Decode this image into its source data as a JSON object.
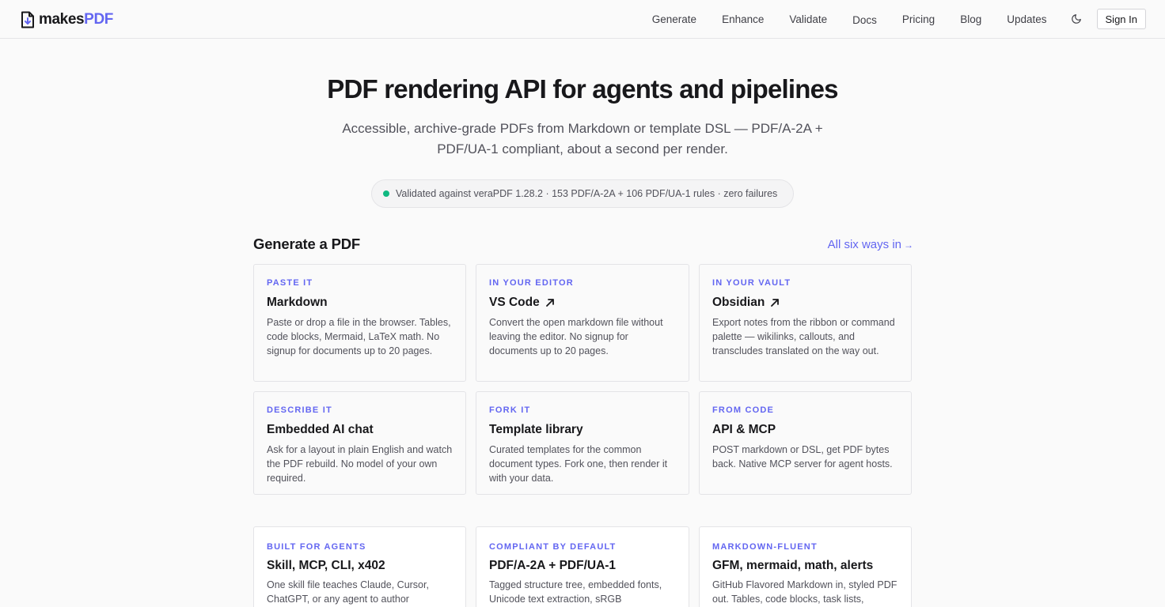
{
  "header": {
    "logo": {
      "prefix": "makes",
      "accent": "PDF",
      "icon": "document-download-icon"
    },
    "nav": [
      {
        "label": "Generate"
      },
      {
        "label": "Enhance"
      },
      {
        "label": "Validate"
      },
      {
        "label": "Docs"
      },
      {
        "label": "Pricing"
      },
      {
        "label": "Blog"
      },
      {
        "label": "Updates"
      }
    ],
    "theme_icon": "moon-icon",
    "signin_label": "Sign In"
  },
  "hero": {
    "title": "PDF rendering API for agents and pipelines",
    "subtitle": "Accessible, archive-grade PDFs from Markdown or template DSL — PDF/A-2A + PDF/UA-1 compliant, about a second per render.",
    "badge": "Validated against veraPDF 1.28.2 · 153 PDF/A-2A + 106 PDF/UA-1 rules · zero failures"
  },
  "generate": {
    "title": "Generate a PDF",
    "link_label": "All six ways in",
    "link_arrow": "→",
    "cards": [
      {
        "kicker": "Paste it",
        "title": "Markdown",
        "external": false,
        "desc": "Paste or drop a file in the browser. Tables, code blocks, Mermaid, LaTeX math. No signup for documents up to 20 pages."
      },
      {
        "kicker": "In your editor",
        "title": "VS Code",
        "external": true,
        "desc": "Convert the open markdown file without leaving the editor. No signup for documents up to 20 pages."
      },
      {
        "kicker": "In your vault",
        "title": "Obsidian",
        "external": true,
        "desc": "Export notes from the ribbon or command palette — wikilinks, callouts, and transcludes translated on the way out."
      },
      {
        "kicker": "Describe it",
        "title": "Embedded AI chat",
        "external": false,
        "desc": "Ask for a layout in plain English and watch the PDF rebuild. No model of your own required."
      },
      {
        "kicker": "Fork it",
        "title": "Template library",
        "external": false,
        "desc": "Curated templates for the common document types. Fork one, then render it with your data."
      },
      {
        "kicker": "From code",
        "title": "API & MCP",
        "external": false,
        "desc": "POST markdown or DSL, get PDF bytes back. Native MCP server for agent hosts."
      }
    ]
  },
  "features": {
    "cards": [
      {
        "kicker": "Built for agents",
        "title": "Skill, MCP, CLI, x402",
        "desc": "One skill file teaches Claude, Cursor, ChatGPT, or any agent to author"
      },
      {
        "kicker": "Compliant by default",
        "title": "PDF/A-2A + PDF/UA-1",
        "desc": "Tagged structure tree, embedded fonts, Unicode text extraction, sRGB"
      },
      {
        "kicker": "Markdown-fluent",
        "title": "GFM, mermaid, math, alerts",
        "desc": "GitHub Flavored Markdown in, styled PDF out. Tables, code blocks, task lists,"
      }
    ]
  },
  "colors": {
    "accent": "#6366f1",
    "status_ok": "#10b981",
    "text": "#18181b",
    "muted": "#52525b",
    "border": "#e4e4e7"
  }
}
